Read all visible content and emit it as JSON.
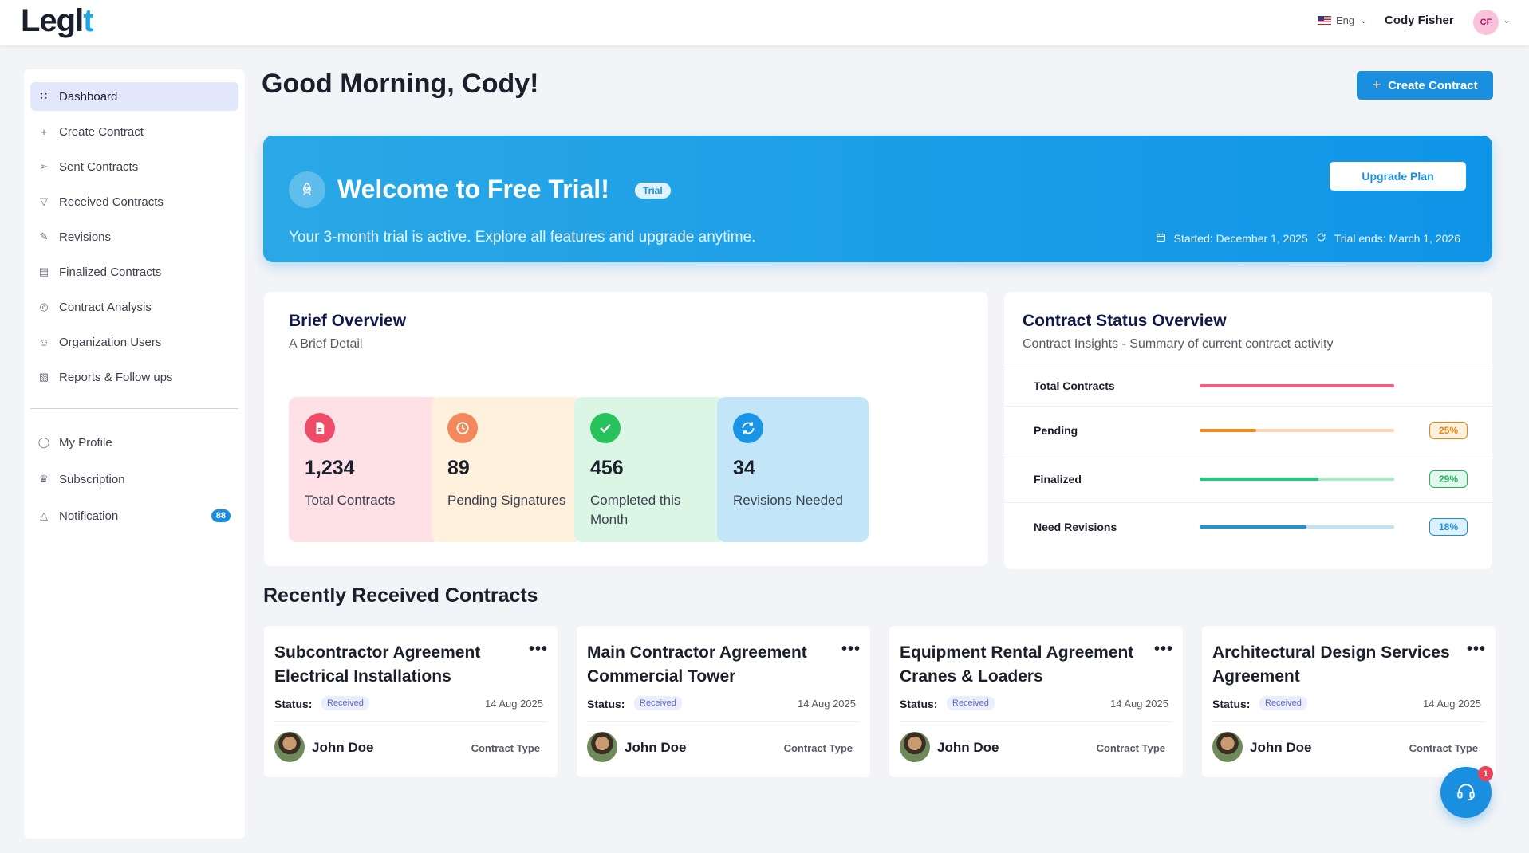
{
  "app": {
    "logo_text": "Legl",
    "logo_mark": "t"
  },
  "topbar": {
    "language": "Eng",
    "user_name": "Cody Fisher",
    "user_initials": "CF"
  },
  "sidebar": {
    "items": [
      {
        "label": "Dashboard",
        "icon": "grid-icon",
        "active": true
      },
      {
        "label": "Create Contract",
        "icon": "plus-icon"
      },
      {
        "label": "Sent Contracts",
        "icon": "send-icon"
      },
      {
        "label": "Received Contracts",
        "icon": "inbox-icon"
      },
      {
        "label": "Revisions",
        "icon": "edit-icon"
      },
      {
        "label": "Finalized Contracts",
        "icon": "calendar-icon"
      },
      {
        "label": "Contract Analysis",
        "icon": "analysis-icon"
      },
      {
        "label": "Organization Users",
        "icon": "users-icon"
      },
      {
        "label": "Reports & Follow ups",
        "icon": "report-icon"
      }
    ],
    "bottom_items": [
      {
        "label": "My Profile",
        "icon": "user-icon"
      },
      {
        "label": "Subscription",
        "icon": "crown-icon"
      },
      {
        "label": "Notification",
        "icon": "bell-icon",
        "badge": "88"
      }
    ]
  },
  "header": {
    "greeting": "Good Morning, Cody!",
    "create_button": "Create Contract"
  },
  "banner": {
    "title": "Welcome to Free Trial!",
    "badge": "Trial",
    "subtitle": "Your 3-month trial is active. Explore all features and upgrade anytime.",
    "upgrade_button": "Upgrade Plan",
    "started": "Started: December 1, 2025",
    "ends": "Trial ends: March 1, 2026"
  },
  "overview": {
    "title": "Brief Overview",
    "subtitle": "A Brief Detail",
    "stats": [
      {
        "value": "1,234",
        "label": "Total Contracts",
        "bg": "#fde1e6",
        "icon_color": "#ef4c6a",
        "icon": "document-icon"
      },
      {
        "value": "89",
        "label": "Pending Signatures",
        "bg": "#fff1dc",
        "icon_color": "#f4875b",
        "icon": "clock-icon"
      },
      {
        "value": "456",
        "label": "Completed this Month",
        "bg": "#dcf6e5",
        "icon_color": "#27c25c",
        "icon": "check-icon"
      },
      {
        "value": "34",
        "label": "Revisions Needed",
        "bg": "#c2e6f7",
        "icon_color": "#1a95e6",
        "icon": "refresh-icon"
      }
    ]
  },
  "status_overview": {
    "title": "Contract Status Overview",
    "subtitle": "Contract Insights - Summary of current contract activity",
    "rows": [
      {
        "label": "Total Contracts",
        "fill": 1.0,
        "track": "#f25f7a",
        "color": "#f25f7a",
        "badge": ""
      },
      {
        "label": "Pending",
        "fill": 0.29,
        "track": "#fbd6b3",
        "color": "#f28a22",
        "badge": "25%",
        "badge_bg": "#fff1dd",
        "badge_color": "#e8850f"
      },
      {
        "label": "Finalized",
        "fill": 0.61,
        "track": "#a3edc3",
        "color": "#1fcb73",
        "badge": "29%",
        "badge_bg": "#e3f8ec",
        "badge_color": "#22b462"
      },
      {
        "label": "Need Revisions",
        "fill": 0.55,
        "track": "#bfe2f6",
        "color": "#1a95e6",
        "badge": "18%",
        "badge_bg": "#ddf0fb",
        "badge_color": "#1a8fe0"
      }
    ]
  },
  "recent": {
    "title": "Recently Received Contracts",
    "contracts": [
      {
        "title": "Subcontractor Agreement Electrical Installations",
        "status_label": "Status:",
        "status": "Received",
        "date": "14 Aug 2025",
        "person": "John Doe",
        "type": "Contract Type"
      },
      {
        "title": "Main Contractor Agreement Commercial Tower",
        "status_label": "Status:",
        "status": "Received",
        "date": "14 Aug 2025",
        "person": "John Doe",
        "type": "Contract Type"
      },
      {
        "title": "Equipment Rental Agreement Cranes & Loaders",
        "status_label": "Status:",
        "status": "Received",
        "date": "14 Aug 2025",
        "person": "John Doe",
        "type": "Contract Type"
      },
      {
        "title": "Architectural Design Services Agreement",
        "status_label": "Status:",
        "status": "Received",
        "date": "14 Aug 2025",
        "person": "John Doe",
        "type": "Contract Type"
      }
    ]
  },
  "support": {
    "badge": "1",
    "icon": "headset-icon"
  },
  "colors": {
    "accent": "#1a8fe0",
    "banner_start": "#2aa8e6",
    "banner_end": "#0f95e8"
  }
}
